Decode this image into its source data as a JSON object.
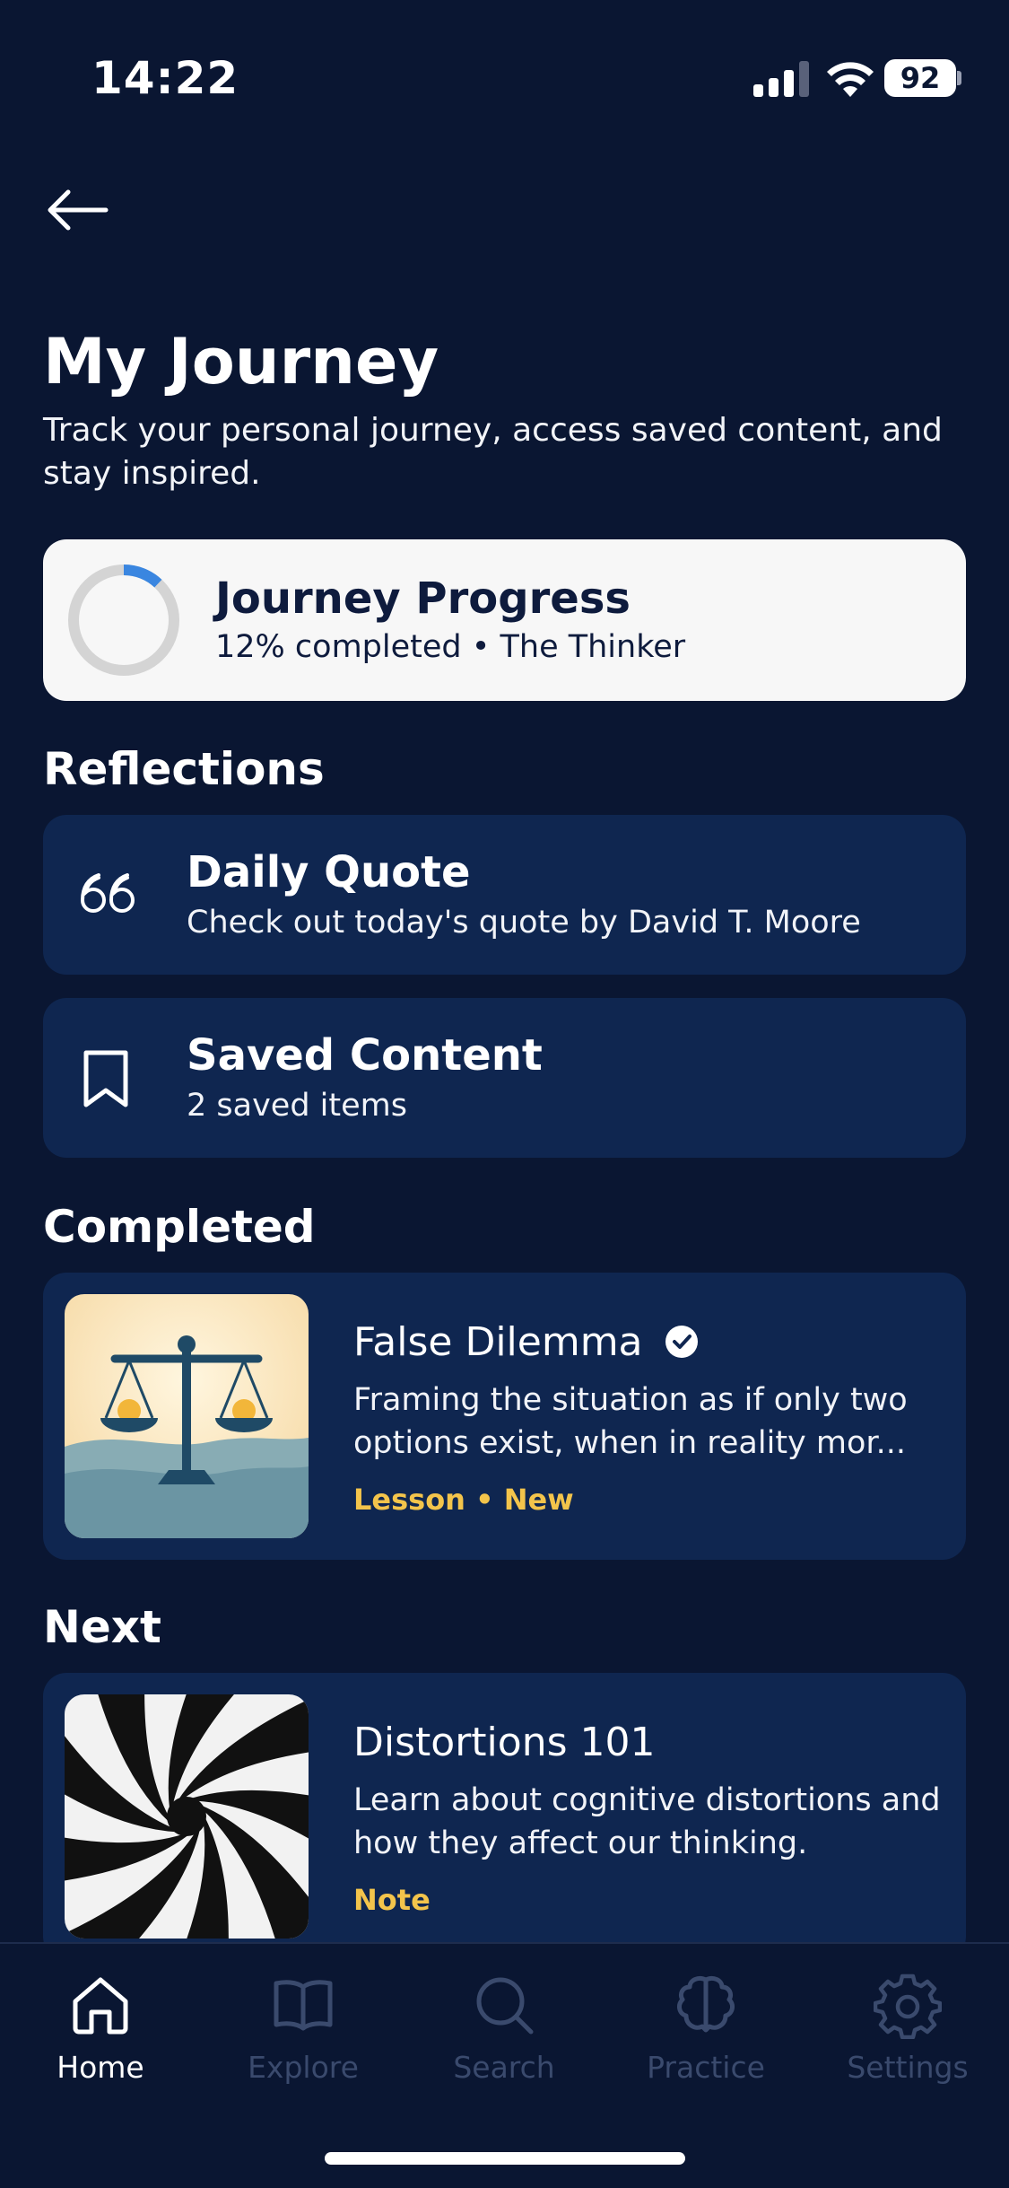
{
  "status_bar": {
    "time": "14:22",
    "battery": "92"
  },
  "header": {
    "title": "My Journey",
    "subtitle": "Track your personal journey, access saved content, and stay inspired."
  },
  "progress": {
    "title": "Journey Progress",
    "subtitle": "12% completed • The Thinker",
    "percent": 12
  },
  "reflections": {
    "section_title": "Reflections",
    "items": [
      {
        "title": "Daily Quote",
        "subtitle": "Check out today's quote by David T. Moore",
        "icon": "quote-icon"
      },
      {
        "title": "Saved Content",
        "subtitle": "2 saved items",
        "icon": "bookmark-icon"
      }
    ]
  },
  "completed": {
    "section_title": "Completed",
    "item": {
      "title": "False Dilemma",
      "description": "Framing the situation as if only two options exist, when in reality mor...",
      "meta": "Lesson • New",
      "badge_icon": "check-circle-icon",
      "thumbnail": "scales-icon"
    }
  },
  "next": {
    "section_title": "Next",
    "item": {
      "title": "Distortions 101",
      "description": "Learn about cognitive distortions and how they affect our thinking.",
      "meta": "Note",
      "thumbnail": "spiral-101-image"
    }
  },
  "tabs": [
    {
      "label": "Home",
      "icon": "home-icon",
      "active": true
    },
    {
      "label": "Explore",
      "icon": "book-icon",
      "active": false
    },
    {
      "label": "Search",
      "icon": "search-icon",
      "active": false
    },
    {
      "label": "Practice",
      "icon": "brain-icon",
      "active": false
    },
    {
      "label": "Settings",
      "icon": "gear-icon",
      "active": false
    }
  ],
  "colors": {
    "background": "#0a1632",
    "card": "#0f2650",
    "accent": "#f3c44b",
    "progress_arc": "#3a86e0"
  }
}
